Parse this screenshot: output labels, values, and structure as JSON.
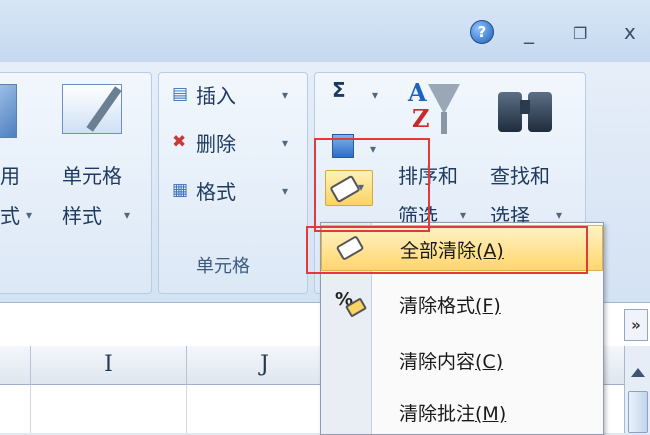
{
  "window": {
    "help_label": "?",
    "minimize": "_",
    "restore": "❐",
    "close": "x"
  },
  "ribbon": {
    "left_partial": {
      "line1": "用",
      "line2": "式"
    },
    "cell_styles": {
      "line1": "单元格",
      "line2": "样式"
    },
    "cells_group": {
      "insert": "插入",
      "delete": "删除",
      "format": "格式",
      "label": "单元格"
    },
    "editing_group": {
      "sigma": "Σ",
      "sort_filter": {
        "line1": "排序和",
        "line2": "筛选"
      },
      "find_select": {
        "line1": "查找和",
        "line2": "选择"
      }
    }
  },
  "menu": {
    "items": [
      {
        "label": "全部清除",
        "accel": "(A)"
      },
      {
        "label": "清除格式",
        "accel": "(F)"
      },
      {
        "label": "清除内容",
        "accel": "(C)"
      },
      {
        "label": "清除批注",
        "accel": "(M)"
      }
    ]
  },
  "columns": [
    "I",
    "J"
  ],
  "colors": {
    "highlight": "#ffd66e",
    "red_outline": "#e03a3a",
    "ribbon": "#d4e2f3"
  }
}
